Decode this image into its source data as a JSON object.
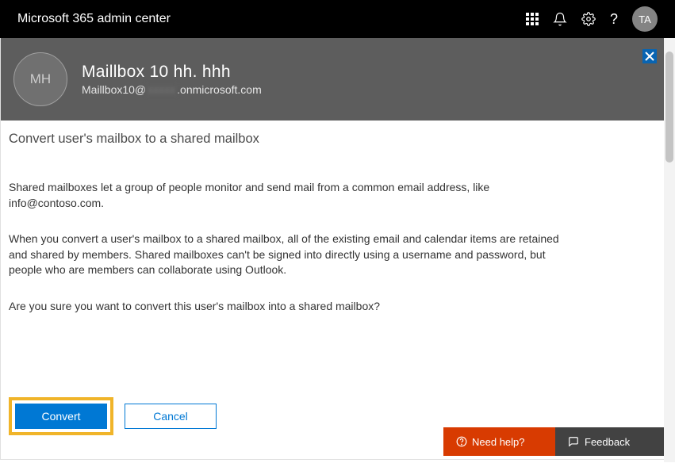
{
  "header": {
    "title": "Microsoft 365 admin center",
    "avatar_initials": "TA"
  },
  "panel": {
    "user_initials": "MH",
    "user_name": "Maillbox 10 hh. hhh",
    "email_prefix": "Maillbox10@",
    "email_redacted": "xxxxx",
    "email_suffix": ".onmicrosoft.com",
    "heading": "Convert user's mailbox to a shared mailbox",
    "para1": "Shared mailboxes let a group of people monitor and send mail from a common email address, like info@contoso.com.",
    "para2": "When you convert a user's mailbox to a shared mailbox, all of the existing email and calendar items are retained and shared by members. Shared mailboxes can't be signed into directly using a username and password, but people who are members can collaborate using Outlook.",
    "para3": "Are you sure you want to convert this user's mailbox into a shared mailbox?",
    "convert_label": "Convert",
    "cancel_label": "Cancel"
  },
  "footer": {
    "need_help": "Need help?",
    "feedback": "Feedback"
  }
}
